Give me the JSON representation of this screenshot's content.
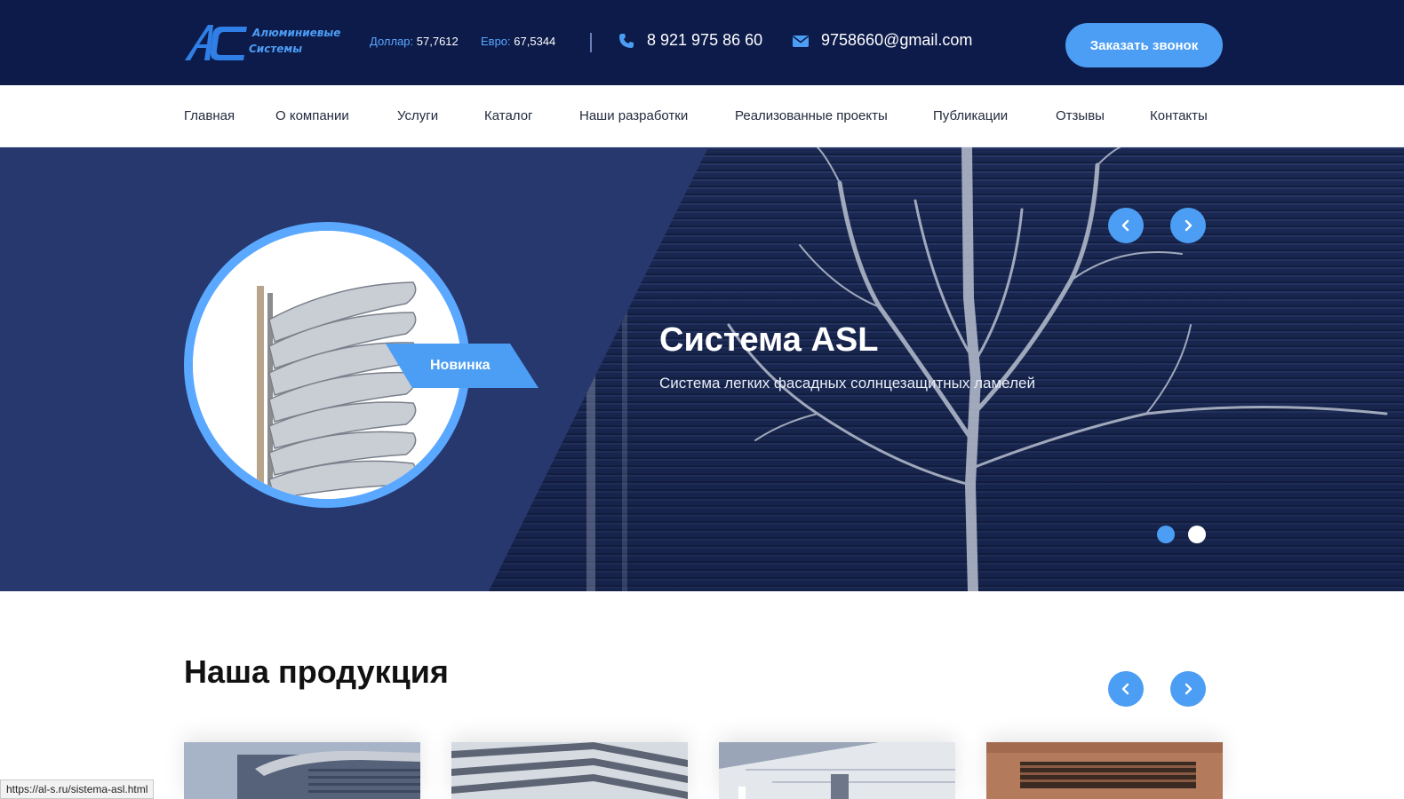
{
  "header": {
    "logo": {
      "line1": "Алюминиевые",
      "line2": "Системы",
      "mark": "AC"
    },
    "rates": {
      "dollar_label": "Доллар:",
      "dollar_value": "57,7612",
      "euro_label": "Евро:",
      "euro_value": "67,5344"
    },
    "phone": "8 921 975 86 60",
    "email": "9758660@gmail.com",
    "callback_label": "Заказать звонок"
  },
  "nav": {
    "items": [
      {
        "label": "Главная"
      },
      {
        "label": "О компании"
      },
      {
        "label": "Услуги"
      },
      {
        "label": "Каталог"
      },
      {
        "label": "Наши разработки"
      },
      {
        "label": "Реализованные проекты"
      },
      {
        "label": "Публикации"
      },
      {
        "label": "Отзывы"
      },
      {
        "label": "Контакты"
      }
    ]
  },
  "hero": {
    "badge": "Новинка",
    "title": "Система ASL",
    "subtitle": "Система легких фасадных солнцезащитных ламелей",
    "slides_total": 2,
    "active_slide": 1
  },
  "products": {
    "title": "Наша продукция"
  },
  "status_bar": {
    "url": "https://al-s.ru/sistema-asl.html"
  },
  "colors": {
    "topbar": "#0d1b4a",
    "accent": "#4b9ef4",
    "hero_panel": "#26386e"
  },
  "icons": {
    "phone": "phone-icon",
    "email": "envelope-icon",
    "prev": "chevron-left-icon",
    "next": "chevron-right-icon"
  }
}
